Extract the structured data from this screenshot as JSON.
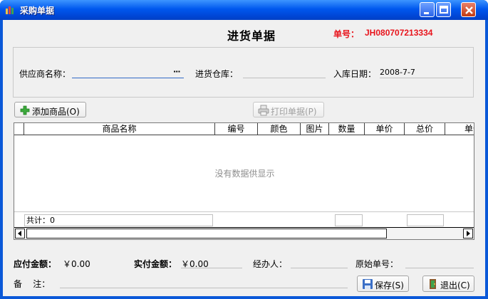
{
  "window": {
    "title": "采购单据",
    "icon": "bar-chart-app-icon",
    "controls": [
      "minimize-icon",
      "maximize-icon",
      "close-icon"
    ]
  },
  "document": {
    "title": "进货单据",
    "number_label": "单号：",
    "number": "JH080707213334",
    "number_color": "#e8141c"
  },
  "header": {
    "supplier_label": "供应商名称：",
    "supplier_value": "",
    "browse_label": "···",
    "warehouse_label": "进货仓库：",
    "warehouse_value": "",
    "date_label": "入库日期：",
    "date_value": "2008-7-7"
  },
  "toolbar": {
    "add_label": "添加商品(O)",
    "print_label": "打印单据(P)"
  },
  "grid": {
    "columns": [
      "商品名称",
      "编号",
      "颜色",
      "图片",
      "数量",
      "单价",
      "总价",
      "单位"
    ],
    "empty_text": "没有数据供显示",
    "footer_total_label": "共计：0"
  },
  "summary": {
    "payable_label": "应付金额：",
    "payable_value": "￥0.00",
    "paid_label": "实付金额：",
    "paid_value": "￥0.00",
    "handler_label": "经办人：",
    "handler_value": "",
    "original_no_label": "原始单号：",
    "original_no_value": "",
    "remark_label": "备    注：",
    "remark_value": ""
  },
  "actions": {
    "save_label": "保存(S)",
    "exit_label": "退出(C)"
  }
}
